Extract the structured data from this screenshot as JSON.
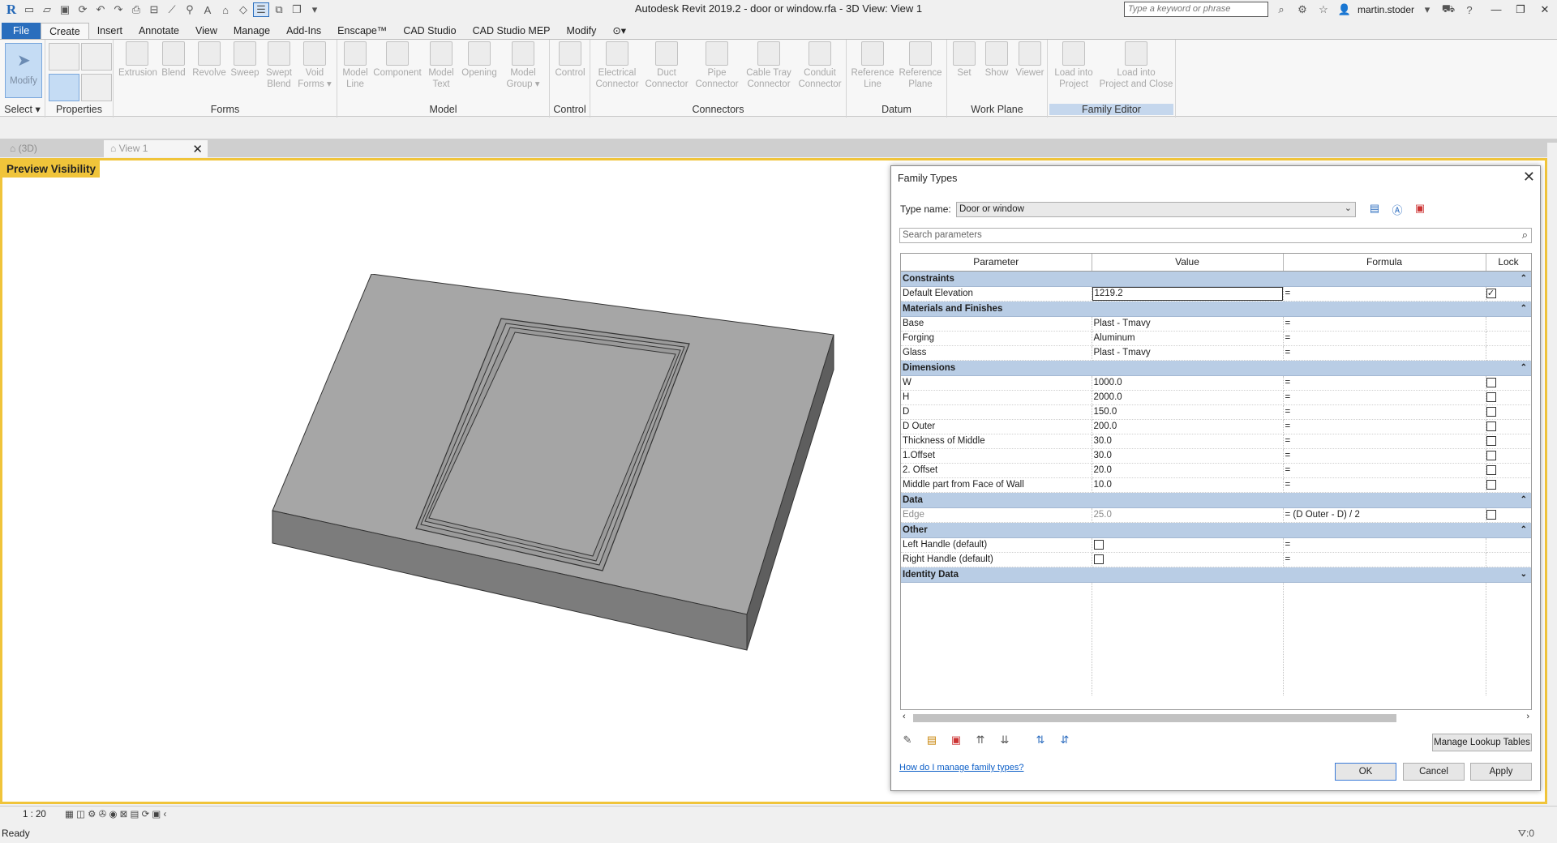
{
  "app": {
    "title": "Autodesk Revit 2019.2 - door or window.rfa - 3D View: View 1",
    "search_placeholder": "Type a keyword or phrase",
    "username": "martin.stoder"
  },
  "menu_tabs": [
    "File",
    "Create",
    "Insert",
    "Annotate",
    "View",
    "Manage",
    "Add-Ins",
    "Enscape™",
    "CAD Studio",
    "CAD Studio MEP",
    "Modify"
  ],
  "ribbon": {
    "modify": "Modify",
    "select": "Select",
    "panels": {
      "properties": "Properties",
      "forms": "Forms",
      "model": "Model",
      "control": "Control",
      "connectors": "Connectors",
      "datum": "Datum",
      "work_plane": "Work Plane",
      "family_editor": "Family Editor"
    },
    "buttons": {
      "extrusion": "Extrusion",
      "blend": "Blend",
      "revolve": "Revolve",
      "sweep": "Sweep",
      "swept_blend_1": "Swept",
      "swept_blend_2": "Blend",
      "void_forms_1": "Void",
      "void_forms_2": "Forms",
      "model_line_1": "Model",
      "model_line_2": "Line",
      "component": "Component",
      "model_text_1": "Model",
      "model_text_2": "Text",
      "opening": "Opening",
      "model_group_1": "Model",
      "model_group_2": "Group",
      "control": "Control",
      "elec_1": "Electrical",
      "elec_2": "Connector",
      "duct_1": "Duct",
      "duct_2": "Connector",
      "pipe_1": "Pipe",
      "pipe_2": "Connector",
      "cable_1": "Cable Tray",
      "cable_2": "Connector",
      "conduit_1": "Conduit",
      "conduit_2": "Connector",
      "refline_1": "Reference",
      "refline_2": "Line",
      "refplane_1": "Reference",
      "refplane_2": "Plane",
      "set": "Set",
      "show": "Show",
      "viewer": "Viewer",
      "load_1": "Load into",
      "load_2": "Project",
      "loadclose_1": "Load into",
      "loadclose_2": "Project and Close"
    }
  },
  "view_tabs": [
    "(3D)",
    "View 1"
  ],
  "viewport": {
    "preview_label": "Preview Visibility",
    "scale": "1 : 20"
  },
  "status": {
    "ready": "Ready",
    "filter_count": ":0"
  },
  "dialog": {
    "title": "Family Types",
    "type_name_label": "Type name:",
    "type_name_value": "Door or window",
    "search_placeholder": "Search parameters",
    "columns": {
      "parameter": "Parameter",
      "value": "Value",
      "formula": "Formula",
      "lock": "Lock"
    },
    "groups": {
      "constraints": "Constraints",
      "materials": "Materials and Finishes",
      "dimensions": "Dimensions",
      "data": "Data",
      "other": "Other",
      "identity": "Identity Data"
    },
    "rows": {
      "default_elevation": {
        "name": "Default Elevation",
        "value": "1219.2",
        "formula": "="
      },
      "base": {
        "name": "Base",
        "value": "Plast - Tmavy",
        "formula": "="
      },
      "forging": {
        "name": "Forging",
        "value": "Aluminum",
        "formula": "="
      },
      "glass": {
        "name": "Glass",
        "value": "Plast - Tmavy",
        "formula": "="
      },
      "w": {
        "name": "W",
        "value": "1000.0",
        "formula": "="
      },
      "h": {
        "name": "H",
        "value": "2000.0",
        "formula": "="
      },
      "d": {
        "name": "D",
        "value": "150.0",
        "formula": "="
      },
      "d_outer": {
        "name": "D Outer",
        "value": "200.0",
        "formula": "="
      },
      "thickness_middle": {
        "name": "Thickness of Middle",
        "value": "30.0",
        "formula": "="
      },
      "offset1": {
        "name": "1.Offset",
        "value": "30.0",
        "formula": "="
      },
      "offset2": {
        "name": "2. Offset",
        "value": "20.0",
        "formula": "="
      },
      "middle_part": {
        "name": "Middle part from Face of Wall",
        "value": "10.0",
        "formula": "="
      },
      "edge": {
        "name": "Edge",
        "value": "25.0",
        "formula": "= (D Outer - D) / 2"
      },
      "left_handle": {
        "name": "Left Handle (default)",
        "formula": "="
      },
      "right_handle": {
        "name": "Right Handle (default)",
        "formula": "="
      }
    },
    "manage_lookup": "Manage Lookup Tables",
    "help_link": "How do I manage family types?",
    "ok": "OK",
    "cancel": "Cancel",
    "apply": "Apply"
  }
}
